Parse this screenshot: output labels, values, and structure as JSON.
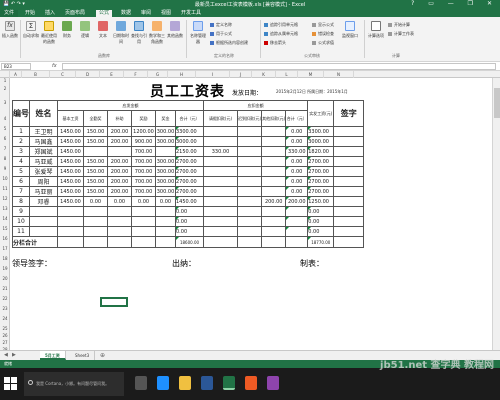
{
  "window": {
    "title": "最新员工excel工资表模板.xls [兼容模式] - Excel",
    "controls": "?  ▭  —  ❐  ✕"
  },
  "tabs": [
    "文件",
    "开始",
    "插入",
    "页面布局",
    "公式",
    "数据",
    "审阅",
    "视图",
    "开发工具"
  ],
  "active_tab": "公式",
  "ribbon": {
    "buttons": [
      "插入函数",
      "自动求和",
      "最近使用的函数",
      "财务",
      "逻辑",
      "文本",
      "日期和时间",
      "查找与引用",
      "数学和三角函数",
      "其他函数",
      "名称管理器",
      "追踪引用单元格",
      "监视窗口",
      "计算选项"
    ],
    "small_items": [
      "定义名称",
      "用于公式",
      "根据所选内容创建",
      "追踪从属单元格",
      "移去箭头",
      "显示公式",
      "错误检查",
      "公式求值",
      "开始计算",
      "计算工作表"
    ],
    "groups": [
      "函数库",
      "定义的名称",
      "公式审核",
      "计算"
    ]
  },
  "formula_bar": {
    "name_box": "B23",
    "fx": "fx",
    "value": ""
  },
  "columns": [
    "A",
    "B",
    "C",
    "D",
    "E",
    "F",
    "G",
    "H",
    "I",
    "J",
    "K",
    "L",
    "M",
    "N"
  ],
  "rows": [
    "1",
    "2",
    "3",
    "4",
    "5",
    "6",
    "7",
    "8",
    "9",
    "10",
    "11",
    "12",
    "13",
    "14",
    "15",
    "16",
    "17",
    "18",
    "19",
    "20",
    "21",
    "22",
    "23",
    "24",
    "25",
    "26",
    "27",
    "28",
    "29",
    "30",
    "31",
    "32"
  ],
  "sheet": {
    "title": "员工工资表",
    "date_label": "发放日期：",
    "date_value": "2015年2月12日  所属日期：2015年1月",
    "header": {
      "no": "编号",
      "name": "姓名",
      "payable": "应发金额",
      "deduct": "应扣金额",
      "actual": "实发工资(元)",
      "sign": "签字",
      "sub_pay": [
        "基本工资",
        "全勤奖",
        "补助",
        "奖励",
        "奖金",
        "合计（元）"
      ],
      "sub_deduct": [
        "请假扣款(元)",
        "迟到扣款(元)",
        "其他扣款(元)",
        "合计（元）"
      ]
    },
    "rows": [
      {
        "no": "1",
        "name": "王卫明",
        "base": "1450.00",
        "full": "150.00",
        "sub": "200.00",
        "reward": "1200.00",
        "bonus": "300.00",
        "total": "3300.00",
        "leave": "",
        "late": "",
        "other": "",
        "dtotal": "0.00",
        "actual": "3300.00"
      },
      {
        "no": "2",
        "name": "马国鑫",
        "base": "1450.00",
        "full": "150.00",
        "sub": "200.00",
        "reward": "900.00",
        "bonus": "300.00",
        "total": "3000.00",
        "leave": "",
        "late": "",
        "other": "",
        "dtotal": "0.00",
        "actual": "3000.00"
      },
      {
        "no": "3",
        "name": "郑国斌",
        "base": "1450.00",
        "full": "",
        "sub": "",
        "reward": "700.00",
        "bonus": "",
        "total": "2150.00",
        "leave": "330.00",
        "late": "",
        "other": "",
        "dtotal": "330.00",
        "actual": "1820.00"
      },
      {
        "no": "4",
        "name": "马亚威",
        "base": "1450.00",
        "full": "150.00",
        "sub": "200.00",
        "reward": "700.00",
        "bonus": "300.00",
        "total": "2700.00",
        "leave": "",
        "late": "",
        "other": "",
        "dtotal": "0.00",
        "actual": "2700.00"
      },
      {
        "no": "5",
        "name": "张爱琴",
        "base": "1450.00",
        "full": "150.00",
        "sub": "200.00",
        "reward": "700.00",
        "bonus": "300.00",
        "total": "2700.00",
        "leave": "",
        "late": "",
        "other": "",
        "dtotal": "0.00",
        "actual": "2700.00"
      },
      {
        "no": "6",
        "name": "周阳",
        "base": "1450.00",
        "full": "150.00",
        "sub": "200.00",
        "reward": "700.00",
        "bonus": "300.00",
        "total": "2700.00",
        "leave": "",
        "late": "",
        "other": "",
        "dtotal": "0.00",
        "actual": "2700.00"
      },
      {
        "no": "7",
        "name": "马亚丽",
        "base": "1450.00",
        "full": "150.00",
        "sub": "200.00",
        "reward": "700.00",
        "bonus": "300.00",
        "total": "2700.00",
        "leave": "",
        "late": "",
        "other": "",
        "dtotal": "0.00",
        "actual": "2700.00"
      },
      {
        "no": "8",
        "name": "邓睿",
        "base": "1450.00",
        "full": "0.00",
        "sub": "0.00",
        "reward": "0.00",
        "bonus": "0.00",
        "total": "1450.00",
        "leave": "",
        "late": "",
        "other": "200.00",
        "dtotal": "200.00",
        "actual": "1250.00"
      },
      {
        "no": "9",
        "name": "",
        "base": "",
        "full": "",
        "sub": "",
        "reward": "",
        "bonus": "",
        "total": "0.00",
        "leave": "",
        "late": "",
        "other": "",
        "dtotal": "",
        "actual": "0.00"
      },
      {
        "no": "10",
        "name": "",
        "base": "",
        "full": "",
        "sub": "",
        "reward": "",
        "bonus": "",
        "total": "0.00",
        "leave": "",
        "late": "",
        "other": "",
        "dtotal": "",
        "actual": "0.00"
      },
      {
        "no": "11",
        "name": "",
        "base": "",
        "full": "",
        "sub": "",
        "reward": "",
        "bonus": "",
        "total": "0.00",
        "leave": "",
        "late": "",
        "other": "",
        "dtotal": "",
        "actual": "0.00"
      }
    ],
    "subtotal_label": "分栏合计",
    "subtotal_pay": "18600.00",
    "subtotal_actual": "18770.00",
    "leader_label": "领导签字：",
    "cashier_label": "出纳：",
    "maker_label": "制表："
  },
  "sheet_tabs": [
    "5月工资",
    "Sheet3"
  ],
  "status": "就绪",
  "taskbar": {
    "search_placeholder": "我是 Cortana，小娜。有问题尽管问我。",
    "time": "",
    "watermark": "jb51.net 查字典 教程网"
  },
  "colors": {
    "excel_green": "#217346",
    "taskbar": "#1b1b1b"
  }
}
